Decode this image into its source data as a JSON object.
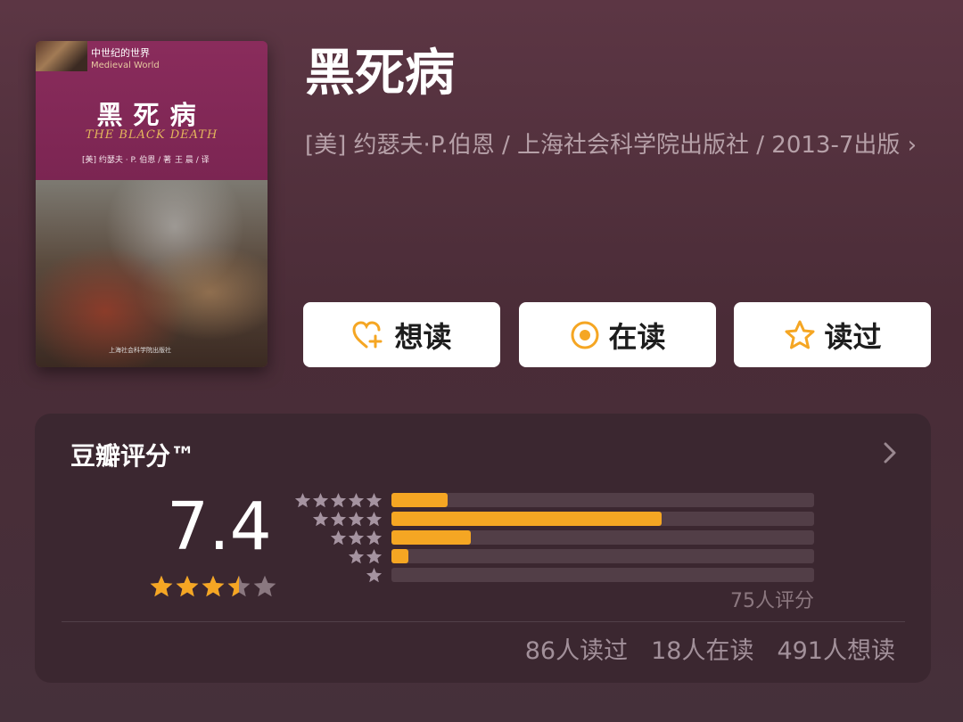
{
  "cover": {
    "series_cn": "中世纪的世界",
    "series_en": "Medieval World",
    "title": "黑死病",
    "subtitle": "THE BLACK DEATH",
    "author_line": "[美] 约瑟夫 · P. 伯恩 / 著",
    "translator_line": "王 晨 / 译",
    "publisher_line": "上海社会科学院出版社"
  },
  "book": {
    "title": "黑死病",
    "meta": "[美] 约瑟夫·P.伯恩 / 上海社会科学院出版社 / 2013-7出版",
    "meta_chevron": "›"
  },
  "actions": [
    {
      "label": "想读",
      "icon": "heart-plus-icon"
    },
    {
      "label": "在读",
      "icon": "target-circle-icon"
    },
    {
      "label": "读过",
      "icon": "star-outline-icon"
    }
  ],
  "rating": {
    "title": "豆瓣评分™",
    "score": "7.4",
    "stars_filled": 3.5,
    "stars_total": 5,
    "distribution_percent": [
      13.3,
      64.0,
      18.7,
      4.0,
      0.0
    ],
    "count_text": "75人评分",
    "stats": [
      "86人读过",
      "18人在读",
      "491人想读"
    ]
  },
  "colors": {
    "accent": "#f5a623",
    "background": "#4f2f3b",
    "card": "#3b2730",
    "button_bg": "#ffffff"
  }
}
